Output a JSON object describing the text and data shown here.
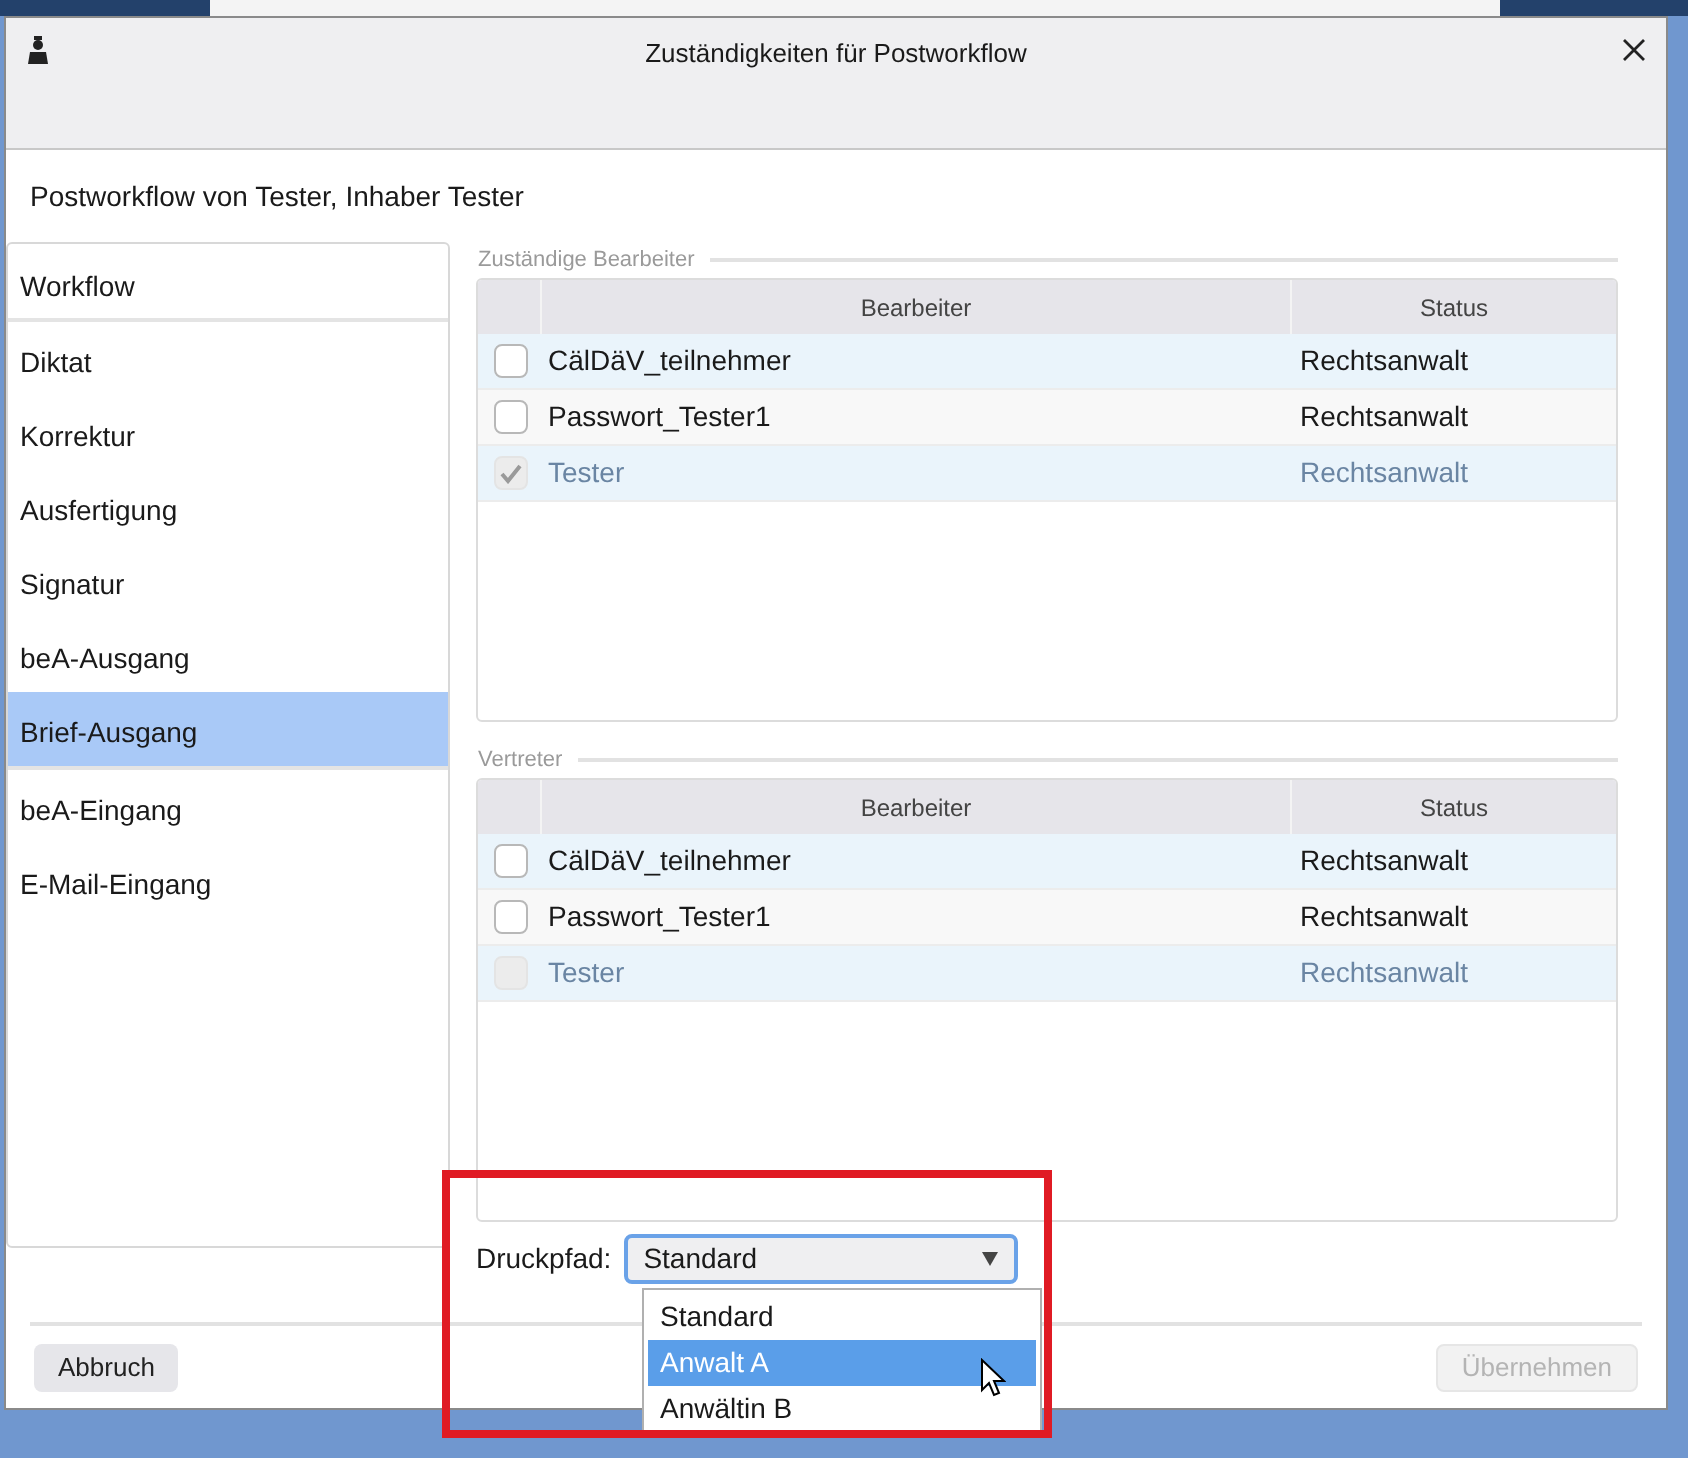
{
  "window": {
    "title": "Zuständigkeiten für Postworkflow"
  },
  "heading": "Postworkflow von Tester, Inhaber Tester",
  "sidebar": {
    "groups": [
      {
        "items": [
          {
            "label": "Workflow",
            "selected": false
          }
        ]
      },
      {
        "items": [
          {
            "label": "Diktat",
            "selected": false
          },
          {
            "label": "Korrektur",
            "selected": false
          },
          {
            "label": "Ausfertigung",
            "selected": false
          },
          {
            "label": "Signatur",
            "selected": false
          },
          {
            "label": "beA-Ausgang",
            "selected": false
          },
          {
            "label": "Brief-Ausgang",
            "selected": true
          }
        ]
      },
      {
        "items": [
          {
            "label": "beA-Eingang",
            "selected": false
          },
          {
            "label": "E-Mail-Eingang",
            "selected": false
          }
        ]
      }
    ]
  },
  "tables": [
    {
      "legend": "Zuständige Bearbeiter",
      "columns": [
        "Bearbeiter",
        "Status"
      ],
      "rows": [
        {
          "name": "CälDäV_teilnehmer",
          "status": "Rechtsanwalt",
          "checked": false,
          "disabled": false
        },
        {
          "name": "Passwort_Tester1",
          "status": "Rechtsanwalt",
          "checked": false,
          "disabled": false
        },
        {
          "name": "Tester",
          "status": "Rechtsanwalt",
          "checked": true,
          "disabled": true
        }
      ]
    },
    {
      "legend": "Vertreter",
      "columns": [
        "Bearbeiter",
        "Status"
      ],
      "rows": [
        {
          "name": "CälDäV_teilnehmer",
          "status": "Rechtsanwalt",
          "checked": false,
          "disabled": false
        },
        {
          "name": "Passwort_Tester1",
          "status": "Rechtsanwalt",
          "checked": false,
          "disabled": false
        },
        {
          "name": "Tester",
          "status": "Rechtsanwalt",
          "checked": false,
          "disabled": true
        }
      ]
    }
  ],
  "print_path": {
    "label": "Druckpfad:",
    "value": "Standard",
    "expanded": true,
    "options": [
      {
        "label": "Standard",
        "highlighted": false
      },
      {
        "label": "Anwalt A",
        "highlighted": true
      },
      {
        "label": "Anwältin B",
        "highlighted": false
      }
    ]
  },
  "buttons": [
    {
      "label": "Abbruch",
      "disabled": false
    },
    {
      "label": "Übernehmen",
      "disabled": true
    }
  ],
  "annotation_frame": true
}
